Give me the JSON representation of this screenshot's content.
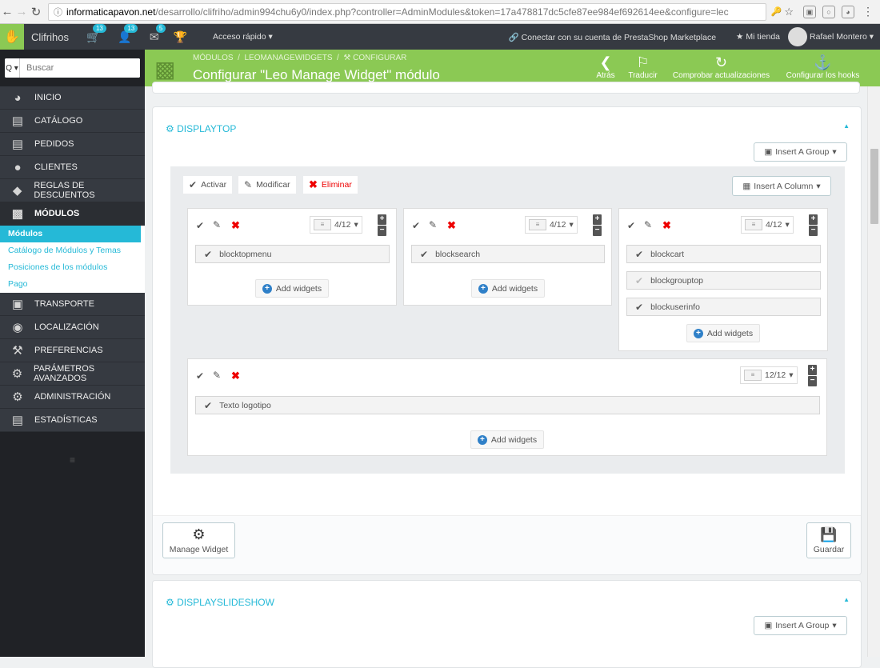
{
  "browser": {
    "url_domain": "informaticapavon.net",
    "url_rest": "/desarrollo/clifriho/admin994chu6y0/index.php?controller=AdminModules&token=17a478817dc5cfe87ee984ef692614ee&configure=lec"
  },
  "header": {
    "shop_name": "Clifrihos",
    "orders_count": "13",
    "customers_count": "13",
    "messages_count": "5",
    "quick_access": "Acceso rápido",
    "marketplace": "Conectar con su cuenta de PrestaShop Marketplace",
    "my_shop": "Mi tienda",
    "user": "Rafael Montero"
  },
  "sidebar": {
    "search_label": "Q",
    "search_placeholder": "Buscar",
    "items": [
      {
        "label": "INICIO",
        "icon": "tachometer-icon"
      },
      {
        "label": "CATÁLOGO",
        "icon": "book-icon"
      },
      {
        "label": "PEDIDOS",
        "icon": "credit-card-icon"
      },
      {
        "label": "CLIENTES",
        "icon": "users-icon"
      },
      {
        "label": "REGLAS DE DESCUENTOS",
        "icon": "tag-icon"
      },
      {
        "label": "MÓDULOS",
        "icon": "puzzle-icon"
      },
      {
        "label": "TRANSPORTE",
        "icon": "truck-icon"
      },
      {
        "label": "LOCALIZACIÓN",
        "icon": "globe-icon"
      },
      {
        "label": "PREFERENCIAS",
        "icon": "wrench-icon"
      },
      {
        "label": "PARÁMETROS AVANZADOS",
        "icon": "cogs-icon"
      },
      {
        "label": "ADMINISTRACIÓN",
        "icon": "cog-icon"
      },
      {
        "label": "ESTADÍSTICAS",
        "icon": "bar-chart-icon"
      }
    ],
    "subitems": [
      {
        "label": "Módulos"
      },
      {
        "label": "Catálogo de Módulos y Temas"
      },
      {
        "label": "Posiciones de los módulos"
      },
      {
        "label": "Pago"
      }
    ]
  },
  "pagehead": {
    "breadcrumb_1": "MÓDULOS",
    "breadcrumb_2": "LEOMANAGEWIDGETS",
    "breadcrumb_3": "CONFIGURAR",
    "title": "Configurar \"Leo Manage Widget\" módulo",
    "toolbar": {
      "back": "Atrás",
      "translate": "Traducir",
      "check_updates": "Comprobar actualizaciones",
      "hooks": "Configurar los hooks"
    }
  },
  "displaytop": {
    "title": "DISPLAYTOP",
    "insert_group": "Insert A Group",
    "insert_column": "Insert A Column",
    "activate": "Activar",
    "modify": "Modificar",
    "delete": "Eliminar",
    "columns": [
      {
        "size": "4/12",
        "widgets": [
          "blocktopmenu"
        ],
        "add": "Add widgets"
      },
      {
        "size": "4/12",
        "widgets": [
          "blocksearch"
        ],
        "add": "Add widgets"
      },
      {
        "size": "4/12",
        "widgets": [
          "blockcart",
          "blockgrouptop",
          "blockuserinfo"
        ],
        "add": "Add widgets"
      },
      {
        "size": "12/12",
        "widgets": [
          "Texto logotipo"
        ],
        "add": "Add widgets"
      }
    ],
    "manage_widget": "Manage Widget",
    "save": "Guardar"
  },
  "displayslideshow": {
    "title": "DISPLAYSLIDESHOW",
    "insert_group": "Insert A Group"
  }
}
